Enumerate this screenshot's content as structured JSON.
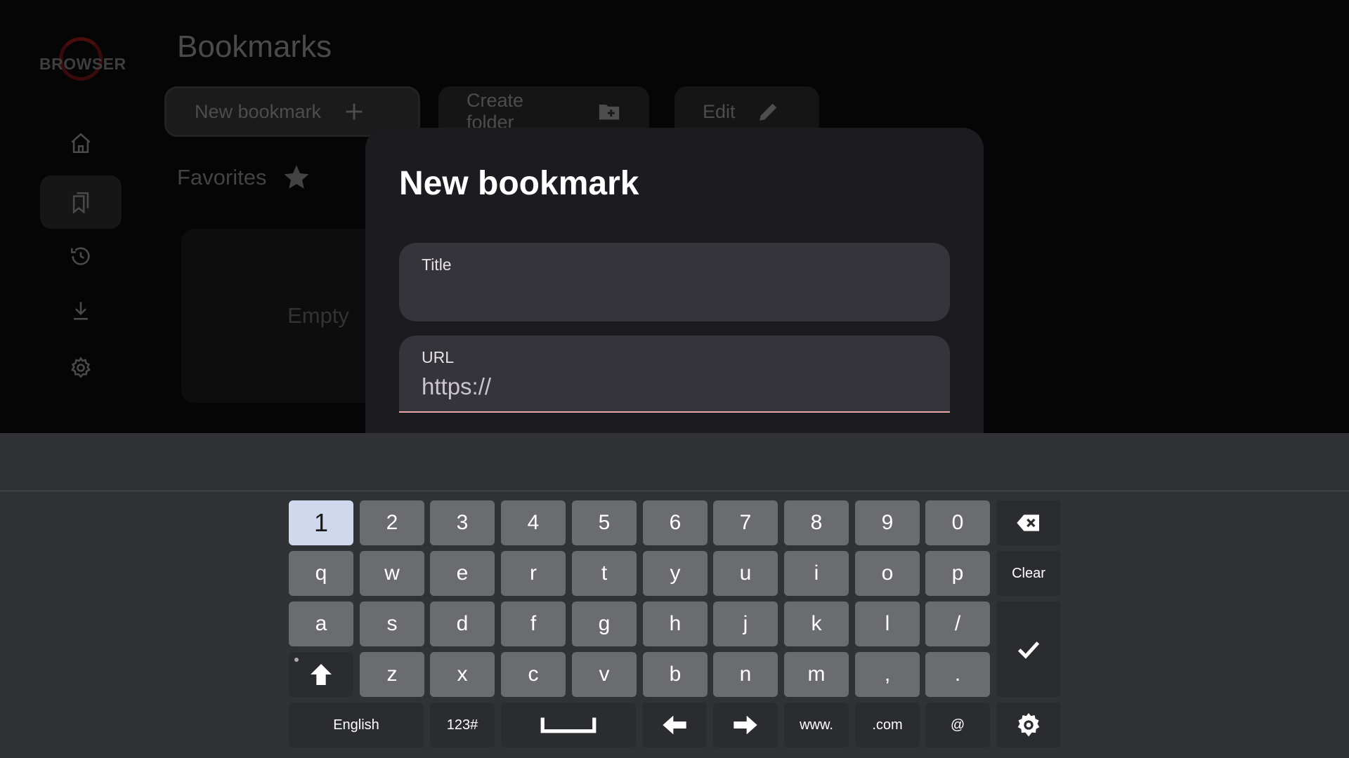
{
  "app": {
    "logo_text": "BROWSER",
    "title": "Bookmarks",
    "new_bookmark_label": "New bookmark",
    "create_folder_label": "Create folder",
    "edit_label": "Edit",
    "favorites_label": "Favorites",
    "empty_label": "Empty",
    "nav": [
      "home-icon",
      "bookmarks-icon",
      "history-icon",
      "downloads-icon",
      "settings-icon"
    ],
    "active_nav": "bookmarks"
  },
  "dialog": {
    "title": "New bookmark",
    "title_field": {
      "label": "Title",
      "value": ""
    },
    "url_field": {
      "label": "URL",
      "value": "https://"
    }
  },
  "keyboard": {
    "row_numbers": [
      "1",
      "2",
      "3",
      "4",
      "5",
      "6",
      "7",
      "8",
      "9",
      "0"
    ],
    "row_q": [
      "q",
      "w",
      "e",
      "r",
      "t",
      "y",
      "u",
      "i",
      "o",
      "p"
    ],
    "row_a": [
      "a",
      "s",
      "d",
      "f",
      "g",
      "h",
      "j",
      "k",
      "l",
      "/"
    ],
    "row_z": [
      "z",
      "x",
      "c",
      "v",
      "b",
      "n",
      "m",
      ",",
      "."
    ],
    "clear_label": "Clear",
    "language_label": "English",
    "symbols_label": "123#",
    "www_label": "www.",
    "com_label": ".com",
    "at_label": "@",
    "highlighted_key": "1",
    "colors": {
      "highlight": "#cfd8ec",
      "key": "#6b6c70",
      "panel": "#303236",
      "accent": "#e8a6aa"
    }
  }
}
